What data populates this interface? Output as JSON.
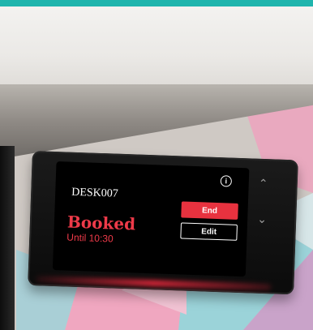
{
  "device": {
    "desk_id": "DESK007",
    "status": "Booked",
    "until": "Until 10:30",
    "end_label": "End",
    "edit_label": "Edit",
    "info_glyph": "i",
    "up_glyph": "⌃",
    "down_glyph": "⌄",
    "icons": [
      "info-icon",
      "chevron-up-icon",
      "chevron-down-icon"
    ]
  },
  "colors": {
    "accent_teal": "#1fb5ad",
    "status_red": "#ee3a49",
    "end_button": "#e8323f"
  }
}
